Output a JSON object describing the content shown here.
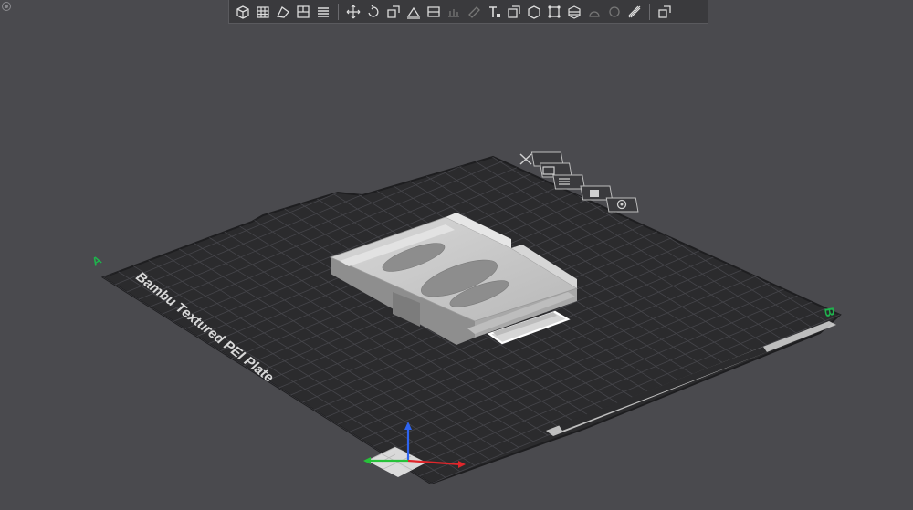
{
  "plate": {
    "label": "Bambu Textured PEI Plate",
    "corner_left_mark": "A",
    "corner_right_mark": "B"
  },
  "plate_tools": [
    {
      "name": "delete-plate-icon"
    },
    {
      "name": "orient-plate-icon"
    },
    {
      "name": "arrange-plate-icon"
    },
    {
      "name": "lock-plate-icon"
    },
    {
      "name": "plate-settings-icon"
    }
  ],
  "toolbar": {
    "groups": [
      [
        "add-object-icon",
        "add-plate-icon",
        "auto-orient-icon",
        "arrange-icon",
        "split-layers-icon"
      ],
      [
        "move-icon",
        "rotate-icon",
        "scale-icon",
        "lay-on-face-icon",
        "cut-icon",
        "support-paint-icon",
        "seam-paint-icon",
        "text-icon",
        "mesh-boolean-icon",
        "measure-icon",
        "assembly-icon",
        "variable-layer-icon",
        "color-paint-icon",
        "brim-ears-icon",
        "emboss-icon"
      ],
      [
        "assembly-view-icon"
      ]
    ]
  },
  "colors": {
    "background": "#4a4a4e",
    "plate": "#2b2b2d",
    "grid": "#47474b",
    "model": "#c9c9c9",
    "selection": "#ffffff",
    "axis_x": "#e0262b",
    "axis_y": "#27c23a",
    "axis_z": "#2e64f0",
    "accent_green": "#1fb24d"
  }
}
